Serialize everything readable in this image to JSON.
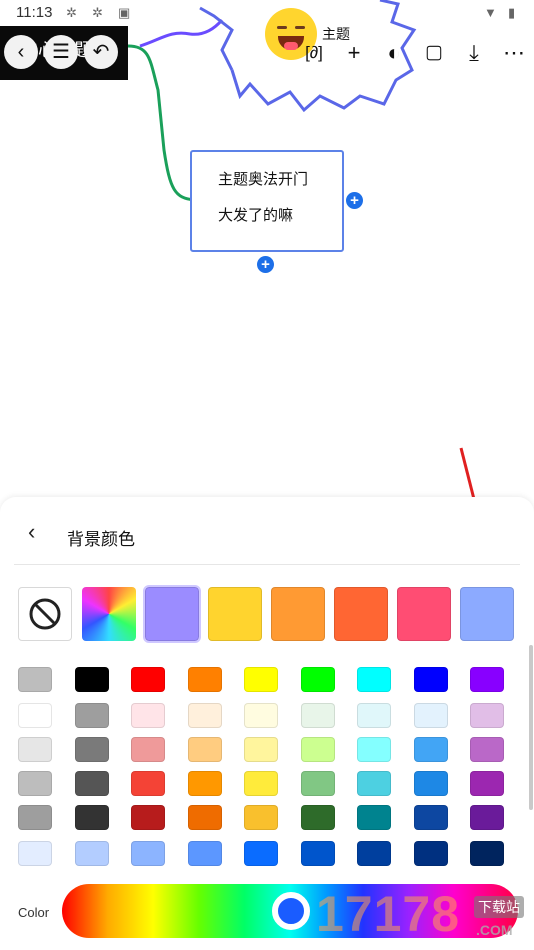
{
  "status_bar": {
    "time": "11:13"
  },
  "nav": {
    "title_partial": "中心主题"
  },
  "canvas": {
    "root_topic": "主题",
    "node": {
      "line1": "主题奥法开门",
      "line2": "大发了的嘛"
    }
  },
  "toolbar": {
    "icons": [
      "formula-icon",
      "add-icon",
      "palette-icon",
      "save-icon",
      "download-icon",
      "more-icon"
    ]
  },
  "sheet": {
    "title": "背景颜色",
    "preset_colors": [
      "#9b8cff",
      "#ffd42e",
      "#ff9a33",
      "#ff6633",
      "#ff4d73",
      "#8caaff"
    ],
    "grid_colors": [
      [
        "#bdbdbd",
        "#000000",
        "#ff0000",
        "#ff8000",
        "#ffff00",
        "#00ff00",
        "#00ffff",
        "#0000ff",
        "#8800ff"
      ],
      [
        "#ffffff",
        "#9e9e9e",
        "#ffe4e8",
        "#fff0dc",
        "#fffce0",
        "#e8f5e9",
        "#e0f7fa",
        "#e3f2fd",
        "#e1bee7"
      ],
      [
        "#e6e6e6",
        "#7a7a7a",
        "#ef9a9a",
        "#ffcc80",
        "#fff59d",
        "#ccff90",
        "#84ffff",
        "#42a5f5",
        "#ba68c8"
      ],
      [
        "#bdbdbd",
        "#555555",
        "#f44336",
        "#ff9800",
        "#ffeb3b",
        "#81c784",
        "#4dd0e1",
        "#1e88e5",
        "#9c27b0"
      ],
      [
        "#9e9e9e",
        "#333333",
        "#b71c1c",
        "#ef6c00",
        "#f9c02d",
        "#2e6b2a",
        "#00838f",
        "#0d47a1",
        "#6a1b9a"
      ],
      [
        "#e3edff",
        "#b3cdff",
        "#8cb4ff",
        "#5c97ff",
        "#0a6cff",
        "#0055cc",
        "#003f9e",
        "#003080",
        "#00245e"
      ]
    ],
    "color_label": "Color"
  },
  "watermark": {
    "text": "17178",
    "sub": "下载站",
    "domain": ".COM"
  }
}
